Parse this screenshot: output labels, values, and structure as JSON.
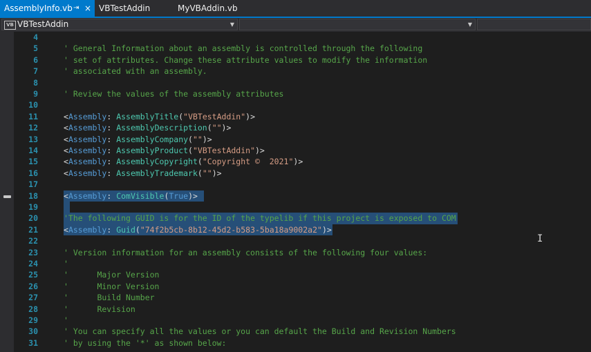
{
  "tabs": [
    {
      "label": "AssemblyInfo.vb",
      "active": true
    },
    {
      "label": "VBTestAddin",
      "active": false
    },
    {
      "label": "MyVBAddin.vb",
      "active": false
    }
  ],
  "tab_pin_icon": "⇥",
  "tab_close_icon": "×",
  "nav": {
    "project_badge": "VB",
    "project": "VBTestAddin",
    "type_selector": "",
    "member_selector": ""
  },
  "code": {
    "l4": {
      "n": "4",
      "c1": ""
    },
    "l5": {
      "n": "5",
      "c1": "' General Information about an assembly is controlled through the following"
    },
    "l6": {
      "n": "6",
      "c1": "' set of attributes. Change these attribute values to modify the information"
    },
    "l7": {
      "n": "7",
      "c1": "' associated with an assembly."
    },
    "l8": {
      "n": "8",
      "c1": ""
    },
    "l9": {
      "n": "9",
      "c1": "' Review the values of the assembly attributes"
    },
    "l10": {
      "n": "10",
      "c1": ""
    },
    "l11": {
      "n": "11",
      "lt": "<",
      "kw": "Assembly",
      "colon": ": ",
      "attr": "AssemblyTitle",
      "open": "(",
      "str": "\"VBTestAddin\"",
      "close": ")>"
    },
    "l12": {
      "n": "12",
      "lt": "<",
      "kw": "Assembly",
      "colon": ": ",
      "attr": "AssemblyDescription",
      "open": "(",
      "str": "\"\"",
      "close": ")>"
    },
    "l13": {
      "n": "13",
      "lt": "<",
      "kw": "Assembly",
      "colon": ": ",
      "attr": "AssemblyCompany",
      "open": "(",
      "str": "\"\"",
      "close": ")>"
    },
    "l14": {
      "n": "14",
      "lt": "<",
      "kw": "Assembly",
      "colon": ": ",
      "attr": "AssemblyProduct",
      "open": "(",
      "str": "\"VBTestAddin\"",
      "close": ")>"
    },
    "l15": {
      "n": "15",
      "lt": "<",
      "kw": "Assembly",
      "colon": ": ",
      "attr": "AssemblyCopyright",
      "open": "(",
      "str": "\"Copyright ©  2021\"",
      "close": ")>"
    },
    "l16": {
      "n": "16",
      "lt": "<",
      "kw": "Assembly",
      "colon": ": ",
      "attr": "AssemblyTrademark",
      "open": "(",
      "str": "\"\"",
      "close": ")>"
    },
    "l17": {
      "n": "17",
      "c1": ""
    },
    "l18": {
      "n": "18",
      "lt": "<",
      "kw": "Assembly",
      "colon": ": ",
      "attr": "ComVisible",
      "open": "(",
      "str": "True",
      "close": ")>"
    },
    "l19": {
      "n": "19",
      "c1": ""
    },
    "l20": {
      "n": "20",
      "c1": "'The following GUID is for the ID of the typelib if this project is exposed to COM"
    },
    "l21": {
      "n": "21",
      "lt": "<",
      "kw": "Assembly",
      "colon": ": ",
      "attr": "Guid",
      "open": "(",
      "str": "\"74f2b5cb-8b12-45d2-b583-5ba18a9002a2\"",
      "close": ")>"
    },
    "l22": {
      "n": "22",
      "c1": ""
    },
    "l23": {
      "n": "23",
      "c1": "' Version information for an assembly consists of the following four values:"
    },
    "l24": {
      "n": "24",
      "c1": "'"
    },
    "l25": {
      "n": "25",
      "c1": "'      Major Version"
    },
    "l26": {
      "n": "26",
      "c1": "'      Minor Version"
    },
    "l27": {
      "n": "27",
      "c1": "'      Build Number"
    },
    "l28": {
      "n": "28",
      "c1": "'      Revision"
    },
    "l29": {
      "n": "29",
      "c1": "'"
    },
    "l30": {
      "n": "30",
      "c1": "' You can specify all the values or you can default the Build and Revision Numbers"
    },
    "l31": {
      "n": "31",
      "c1": "' by using the '*' as shown below:"
    }
  },
  "colors": {
    "accent": "#007acc",
    "selection": "#264f78",
    "comment": "#57a64a",
    "keyword": "#569cd6",
    "type": "#4ec9b0",
    "string": "#d69d85",
    "line_number": "#2b91af"
  }
}
